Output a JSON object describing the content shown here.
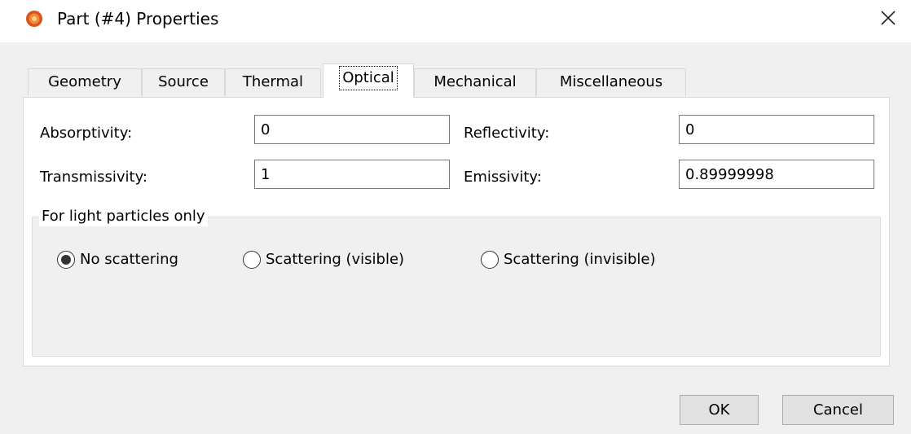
{
  "window": {
    "title": "Part (#4) Properties",
    "app_icon": "sun-icon",
    "close_icon": "close-icon"
  },
  "tabs": [
    {
      "label": "Geometry",
      "active": false
    },
    {
      "label": "Source",
      "active": false
    },
    {
      "label": "Thermal",
      "active": false
    },
    {
      "label": "Optical",
      "active": true
    },
    {
      "label": "Mechanical",
      "active": false
    },
    {
      "label": "Miscellaneous",
      "active": false
    }
  ],
  "optical": {
    "absorptivity": {
      "label": "Absorptivity:",
      "value": "0"
    },
    "reflectivity": {
      "label": "Reflectivity:",
      "value": "0"
    },
    "transmissivity": {
      "label": "Transmissivity:",
      "value": "1"
    },
    "emissivity": {
      "label": "Emissivity:",
      "value": "0.89999998"
    }
  },
  "light_particles": {
    "title": "For light particles only",
    "options": [
      {
        "label": "No scattering",
        "selected": true
      },
      {
        "label": "Scattering (visible)",
        "selected": false
      },
      {
        "label": "Scattering (invisible)",
        "selected": false
      }
    ]
  },
  "buttons": {
    "ok": "OK",
    "cancel": "Cancel"
  },
  "colors": {
    "window_bg": "#f0f0f0",
    "panel_bg": "#ffffff",
    "icon_orange": "#e8642a"
  }
}
